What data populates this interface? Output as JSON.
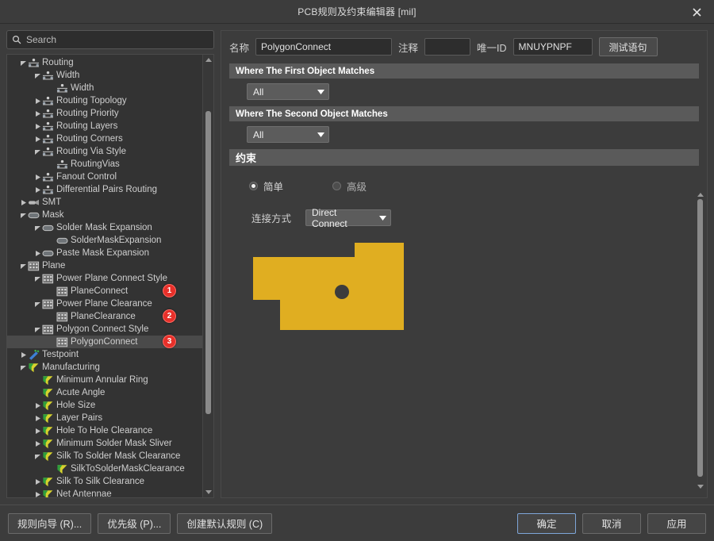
{
  "window": {
    "title": "PCB规则及约束编辑器 [mil]",
    "close_icon": "close-icon"
  },
  "search": {
    "placeholder": "Search",
    "icon": "search-icon"
  },
  "tree": {
    "items": [
      {
        "label": "Routing",
        "depth": 1,
        "icon": "routing-icon",
        "state": "expanded"
      },
      {
        "label": "Width",
        "depth": 2,
        "icon": "routing-icon",
        "state": "expanded"
      },
      {
        "label": "Width",
        "depth": 3,
        "icon": "routing-icon",
        "state": "leaf"
      },
      {
        "label": "Routing Topology",
        "depth": 2,
        "icon": "routing-icon",
        "state": "collapsed"
      },
      {
        "label": "Routing Priority",
        "depth": 2,
        "icon": "routing-icon",
        "state": "collapsed"
      },
      {
        "label": "Routing Layers",
        "depth": 2,
        "icon": "routing-icon",
        "state": "collapsed"
      },
      {
        "label": "Routing Corners",
        "depth": 2,
        "icon": "routing-icon",
        "state": "collapsed"
      },
      {
        "label": "Routing Via Style",
        "depth": 2,
        "icon": "routing-icon",
        "state": "expanded"
      },
      {
        "label": "RoutingVias",
        "depth": 3,
        "icon": "routing-icon",
        "state": "leaf"
      },
      {
        "label": "Fanout Control",
        "depth": 2,
        "icon": "routing-icon",
        "state": "collapsed"
      },
      {
        "label": "Differential Pairs Routing",
        "depth": 2,
        "icon": "routing-icon",
        "state": "collapsed"
      },
      {
        "label": "SMT",
        "depth": 1,
        "icon": "smt-icon",
        "state": "collapsed"
      },
      {
        "label": "Mask",
        "depth": 1,
        "icon": "mask-icon",
        "state": "expanded"
      },
      {
        "label": "Solder Mask Expansion",
        "depth": 2,
        "icon": "mask-icon",
        "state": "expanded"
      },
      {
        "label": "SolderMaskExpansion",
        "depth": 3,
        "icon": "mask-icon",
        "state": "leaf"
      },
      {
        "label": "Paste Mask Expansion",
        "depth": 2,
        "icon": "mask-icon",
        "state": "collapsed"
      },
      {
        "label": "Plane",
        "depth": 1,
        "icon": "plane-icon",
        "state": "expanded"
      },
      {
        "label": "Power Plane Connect Style",
        "depth": 2,
        "icon": "plane-icon",
        "state": "expanded"
      },
      {
        "label": "PlaneConnect",
        "depth": 3,
        "icon": "plane-icon",
        "state": "leaf",
        "badge": "1"
      },
      {
        "label": "Power Plane Clearance",
        "depth": 2,
        "icon": "plane-icon",
        "state": "expanded"
      },
      {
        "label": "PlaneClearance",
        "depth": 3,
        "icon": "plane-icon",
        "state": "leaf",
        "badge": "2"
      },
      {
        "label": "Polygon Connect Style",
        "depth": 2,
        "icon": "plane-icon",
        "state": "expanded"
      },
      {
        "label": "PolygonConnect",
        "depth": 3,
        "icon": "plane-icon",
        "state": "leaf",
        "badge": "3",
        "selected": true
      },
      {
        "label": "Testpoint",
        "depth": 1,
        "icon": "testpoint-icon",
        "state": "collapsed"
      },
      {
        "label": "Manufacturing",
        "depth": 1,
        "icon": "manufacturing-icon",
        "state": "expanded"
      },
      {
        "label": "Minimum Annular Ring",
        "depth": 2,
        "icon": "manufacturing-icon",
        "state": "leaf"
      },
      {
        "label": "Acute Angle",
        "depth": 2,
        "icon": "manufacturing-icon",
        "state": "leaf"
      },
      {
        "label": "Hole Size",
        "depth": 2,
        "icon": "manufacturing-icon",
        "state": "collapsed"
      },
      {
        "label": "Layer Pairs",
        "depth": 2,
        "icon": "manufacturing-icon",
        "state": "collapsed"
      },
      {
        "label": "Hole To Hole Clearance",
        "depth": 2,
        "icon": "manufacturing-icon",
        "state": "collapsed"
      },
      {
        "label": "Minimum Solder Mask Sliver",
        "depth": 2,
        "icon": "manufacturing-icon",
        "state": "collapsed"
      },
      {
        "label": "Silk To Solder Mask Clearance",
        "depth": 2,
        "icon": "manufacturing-icon",
        "state": "expanded"
      },
      {
        "label": "SilkToSolderMaskClearance",
        "depth": 3,
        "icon": "manufacturing-icon",
        "state": "leaf"
      },
      {
        "label": "Silk To Silk Clearance",
        "depth": 2,
        "icon": "manufacturing-icon",
        "state": "collapsed"
      },
      {
        "label": "Net Antennae",
        "depth": 2,
        "icon": "manufacturing-icon",
        "state": "collapsed"
      }
    ]
  },
  "form": {
    "name_label": "名称",
    "name_value": "PolygonConnect",
    "comment_label": "注释",
    "comment_value": "",
    "uid_label": "唯一ID",
    "uid_value": "MNUYPNPF",
    "test_query_button": "测试语句"
  },
  "first_object": {
    "header": "Where The First Object Matches",
    "scope_value": "All"
  },
  "second_object": {
    "header": "Where The Second Object Matches",
    "scope_value": "All"
  },
  "constraints": {
    "header": "约束",
    "simple_label": "简单",
    "advanced_label": "高级",
    "selected_mode": "简单",
    "connect_style_label": "连接方式",
    "connect_style_value": "Direct Connect",
    "pad_color": "#e0ae21",
    "hole_color": "#3c3c3c"
  },
  "footer": {
    "rule_wizard": "规则向导 (R)...",
    "priorities": "优先级 (P)...",
    "create_default_rules": "创建默认规则 (C)",
    "ok": "确定",
    "cancel": "取消",
    "apply": "应用"
  },
  "colors": {
    "accent": "#7ea6d8",
    "badge": "#e8302a",
    "pad": "#e0ae21"
  }
}
